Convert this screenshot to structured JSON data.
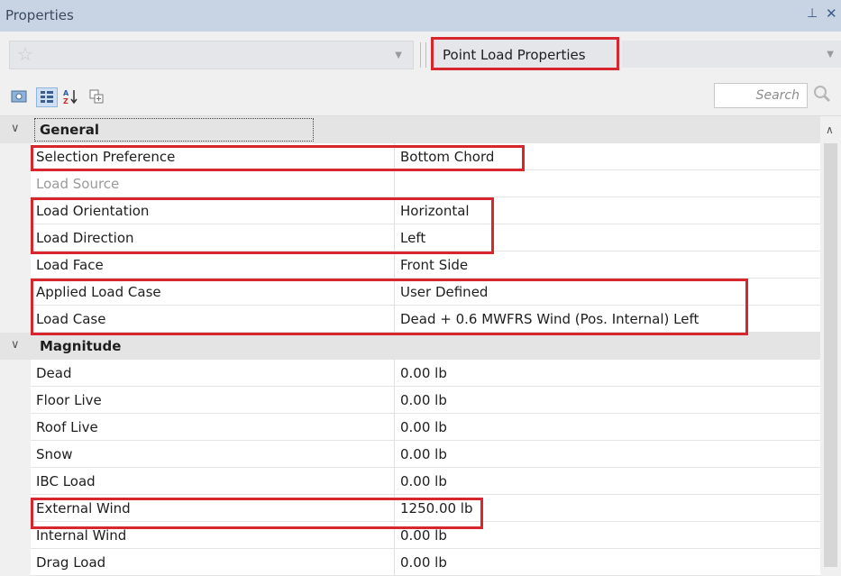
{
  "panel": {
    "title": "Properties",
    "pin_icon": "pin-icon",
    "close_icon": "close-icon"
  },
  "selector": {
    "left_value": "",
    "right_value": "Point Load Properties"
  },
  "toolbar": {
    "search_placeholder": "Search"
  },
  "categories": [
    {
      "label": "General",
      "rows": [
        {
          "name": "Selection Preference",
          "value": "Bottom Chord"
        },
        {
          "name": "Load Source",
          "value": ""
        },
        {
          "name": "Load Orientation",
          "value": "Horizontal"
        },
        {
          "name": "Load Direction",
          "value": "Left"
        },
        {
          "name": "Load Face",
          "value": "Front Side"
        },
        {
          "name": "Applied Load Case",
          "value": "User Defined"
        },
        {
          "name": "Load Case",
          "value": "Dead + 0.6 MWFRS Wind (Pos. Internal) Left"
        }
      ]
    },
    {
      "label": "Magnitude",
      "rows": [
        {
          "name": "Dead",
          "value": "0.00 lb"
        },
        {
          "name": "Floor Live",
          "value": "0.00 lb"
        },
        {
          "name": "Roof Live",
          "value": "0.00 lb"
        },
        {
          "name": "Snow",
          "value": "0.00 lb"
        },
        {
          "name": "IBC Load",
          "value": "0.00 lb"
        },
        {
          "name": "External Wind",
          "value": "1250.00 lb"
        },
        {
          "name": "Internal Wind",
          "value": "0.00 lb"
        },
        {
          "name": "Drag Load",
          "value": "0.00 lb"
        }
      ]
    }
  ],
  "colors": {
    "highlight": "#d7262e",
    "titlebar": "#c8d4e4",
    "category_bg": "#e4e4e4"
  }
}
